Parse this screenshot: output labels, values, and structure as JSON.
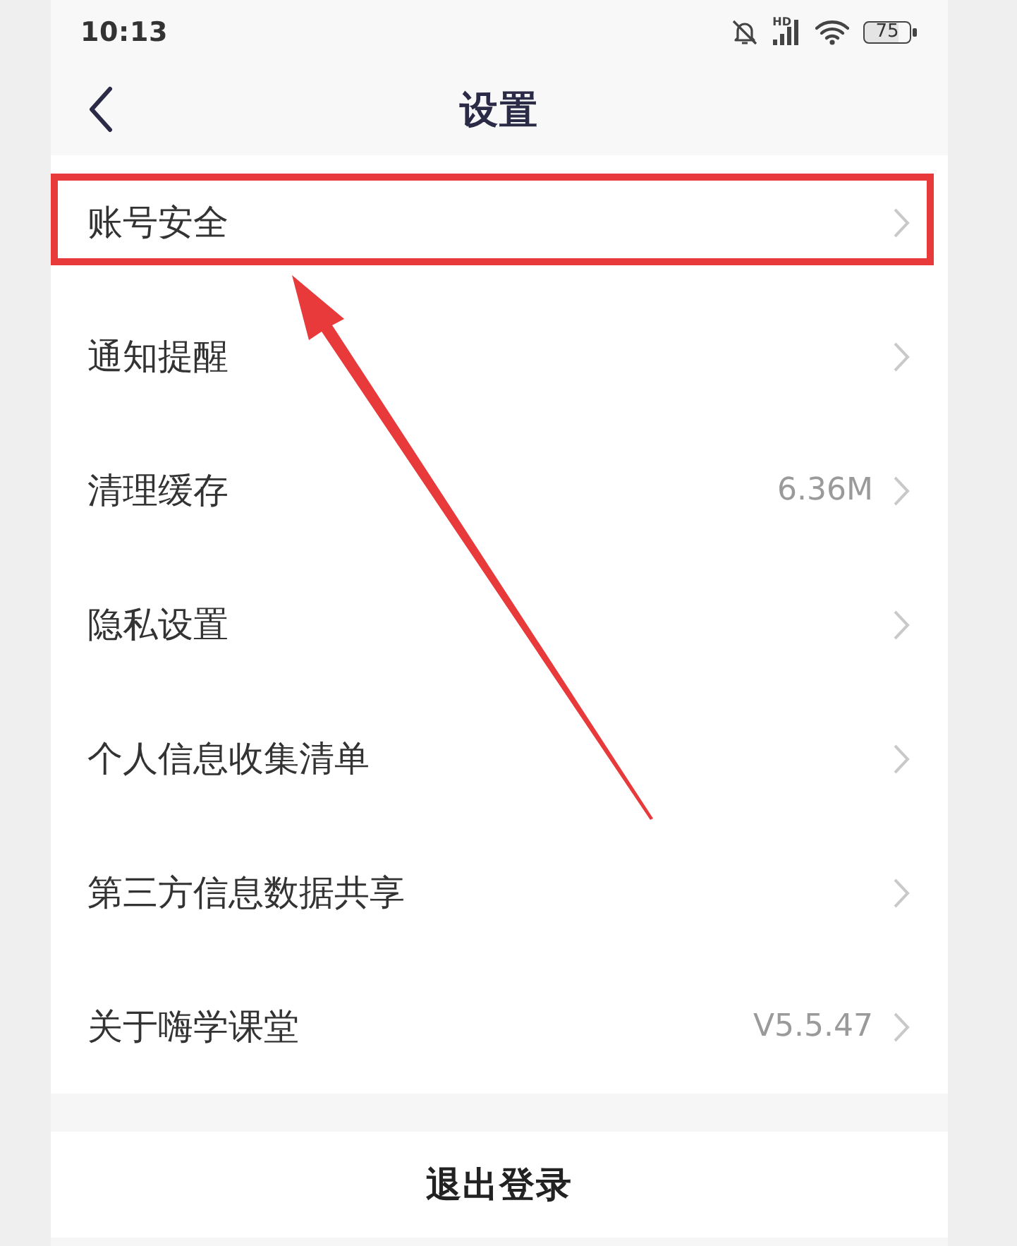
{
  "status_bar": {
    "time": "10:13",
    "network": "HD",
    "battery": "75"
  },
  "header": {
    "title": "设置"
  },
  "settings": [
    {
      "label": "账号安全",
      "highlighted": true
    },
    {
      "label": "通知提醒",
      "highlighted": false
    },
    {
      "label": "清理缓存",
      "value": "6.36M",
      "highlighted": false
    },
    {
      "label": "隐私设置",
      "highlighted": false
    },
    {
      "label": "个人信息收集清单",
      "highlighted": false
    },
    {
      "label": "第三方信息数据共享",
      "highlighted": false
    },
    {
      "label": "关于嗨学课堂",
      "value": "V5.5.47",
      "highlighted": false
    }
  ],
  "logout": {
    "label": "退出登录"
  }
}
